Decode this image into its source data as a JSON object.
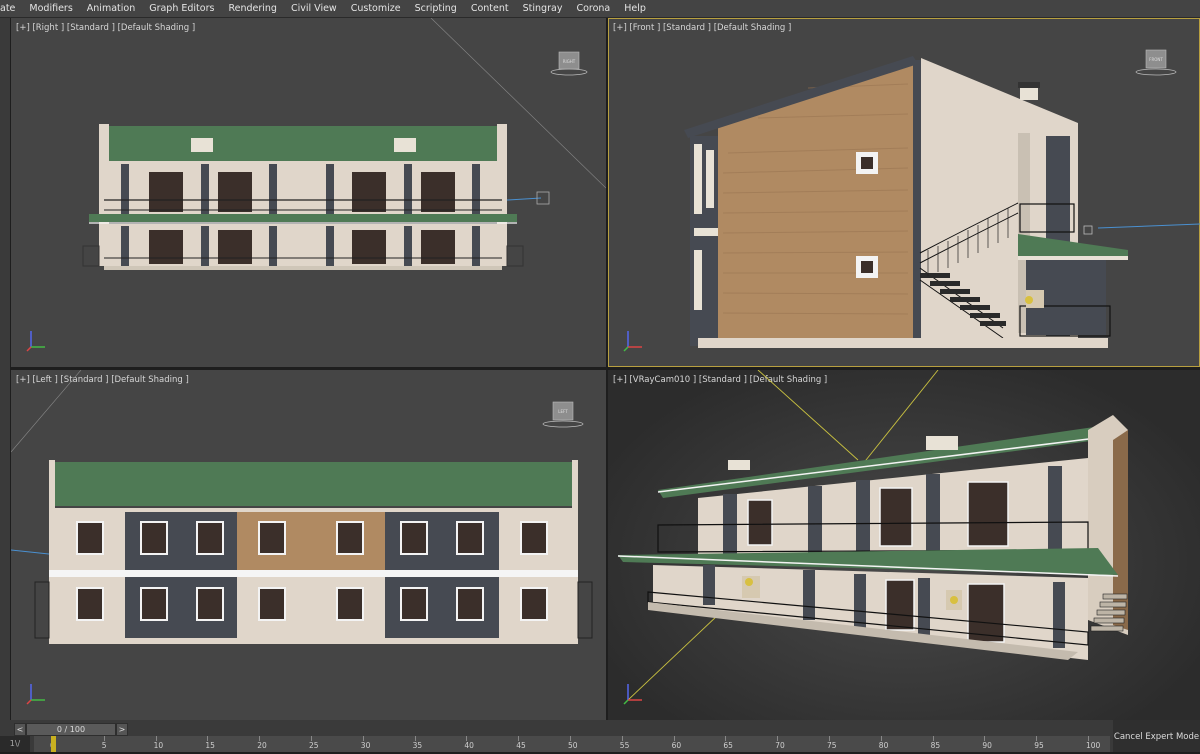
{
  "menu": [
    "ate",
    "Modifiers",
    "Animation",
    "Graph Editors",
    "Rendering",
    "Civil View",
    "Customize",
    "Scripting",
    "Content",
    "Stingray",
    "Corona",
    "Help"
  ],
  "viewports": {
    "top_left": {
      "label": "[+] [Right ] [Standard ] [Default Shading ]",
      "cube_text": "RIGHT"
    },
    "top_right": {
      "label": "[+] [Front ] [Standard ] [Default Shading ]",
      "cube_text": "FRONT"
    },
    "bottom_left": {
      "label": "[+] [Left ] [Standard ] [Default Shading ]",
      "cube_text": "LEFT"
    },
    "bottom_right": {
      "label": "[+] [VRayCam010 ] [Standard ] [Default Shading ]"
    }
  },
  "timeline": {
    "counter": "0 / 100",
    "prev_icon": "<",
    "next_icon": ">"
  },
  "ruler_ticks": [
    "0",
    "5",
    "10",
    "15",
    "20",
    "25",
    "30",
    "35",
    "40",
    "45",
    "50",
    "55",
    "60",
    "65",
    "70",
    "75",
    "80",
    "85",
    "90",
    "95",
    "100"
  ],
  "listener_label": "1\\/",
  "cancel_expert_label": "Cancel Expert Mode",
  "colors": {
    "viewport_bg": "#454545",
    "roof_green": "#4f7a55",
    "wall_beige": "#e0d6ca",
    "dark_panel": "#464a52",
    "wood": "#b08a62",
    "active_border": "#b8a040"
  }
}
